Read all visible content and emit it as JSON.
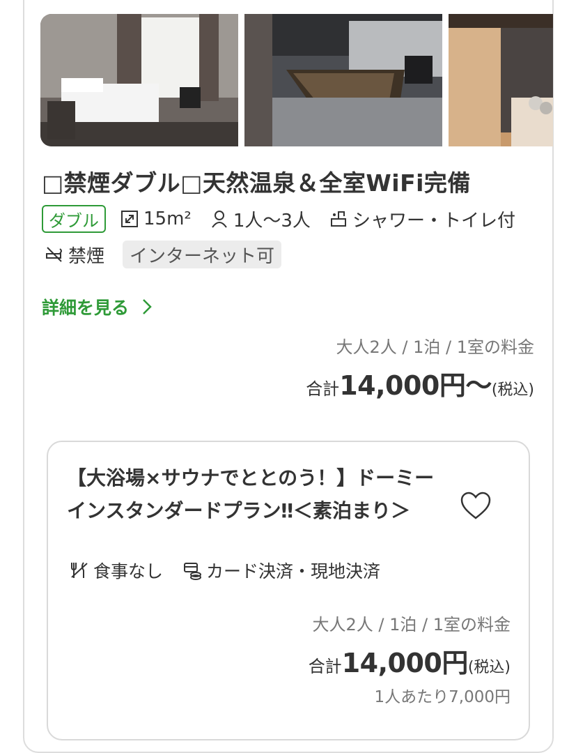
{
  "room": {
    "photos": [
      "room-bedroom-photo",
      "onsen-bath-photo",
      "sauna-photo"
    ],
    "title": "□禁煙ダブル□天然温泉＆全室WiFi完備",
    "room_type_tag": "ダブル",
    "size": "15m²",
    "capacity": "1人〜3人",
    "bath": "シャワー・トイレ付",
    "smoking": "禁煙",
    "internet_tag": "インターネット可",
    "details_link": "詳細を見る",
    "price_condition": "大人2人 / 1泊 / 1室の料金",
    "price_label": "合計",
    "price_amount": "14,000円〜",
    "price_tax": "(税込)"
  },
  "plan": {
    "title": "【大浴場×サウナでととのう！】ドーミーインスタンダードプラン‼＜素泊まり＞",
    "meal": "食事なし",
    "payment": "カード決済・現地決済",
    "price_condition": "大人2人 / 1泊 / 1室の料金",
    "price_label": "合計",
    "price_amount": "14,000円",
    "price_tax": "(税込)",
    "per_person": "1人あたり7,000円"
  },
  "colors": {
    "accent_green": "#2e9a37",
    "text_dark": "#333333",
    "text_gray": "#777777",
    "border": "#dddddd"
  },
  "icons": [
    "size-icon",
    "person-icon",
    "bath-toilet-icon",
    "no-smoking-icon",
    "chevron-right-icon",
    "heart-icon",
    "no-meal-icon",
    "payment-icon"
  ]
}
